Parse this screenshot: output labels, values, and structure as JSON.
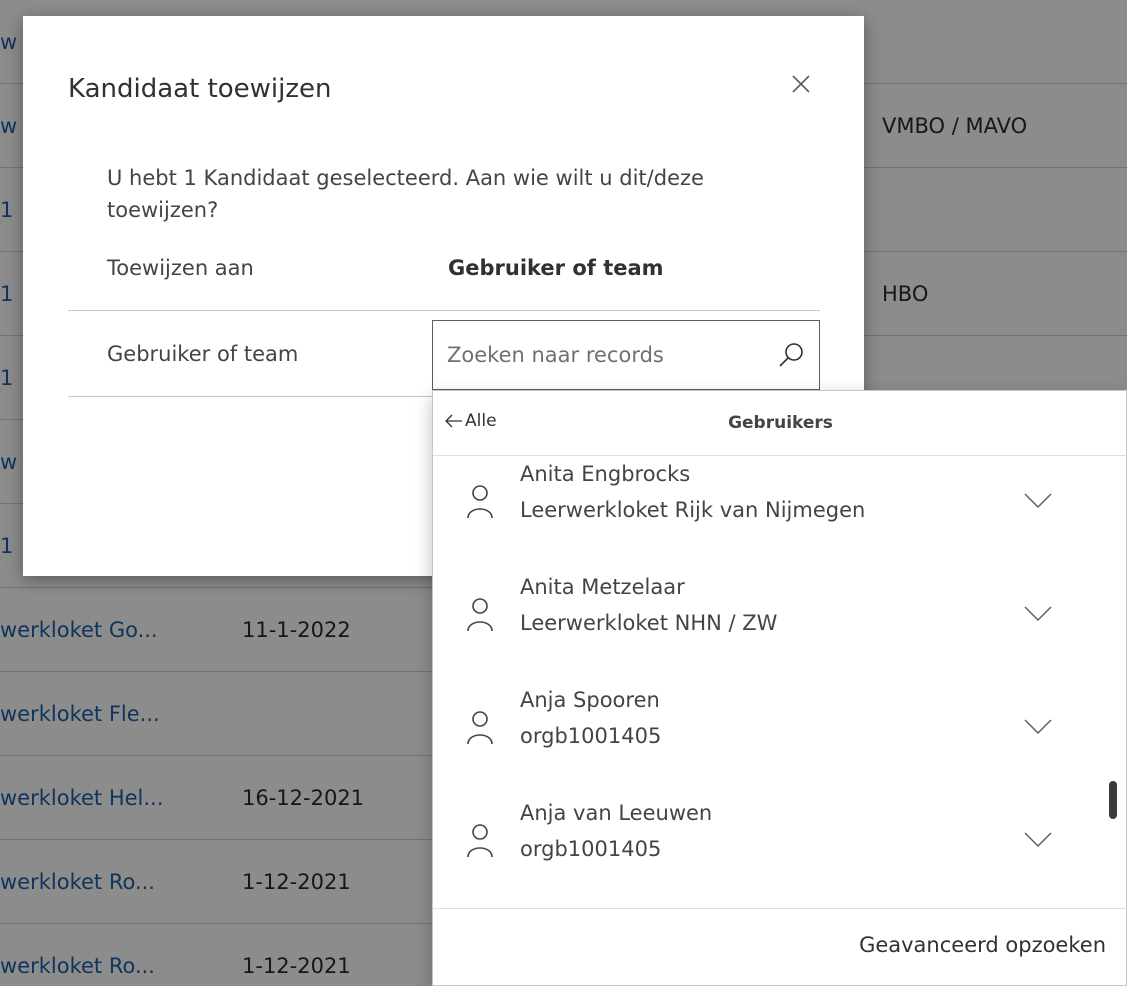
{
  "background_table": {
    "rows": [
      {
        "col1": "w",
        "col2": "",
        "col3": ""
      },
      {
        "col1": "w",
        "col2": "",
        "col3": "VMBO / MAVO"
      },
      {
        "col1": "1",
        "col2": "",
        "col3": ""
      },
      {
        "col1": "1",
        "col2": "",
        "col3": "HBO"
      },
      {
        "col1": "1",
        "col2": "",
        "col3": ""
      },
      {
        "col1": "w",
        "col2": "",
        "col3": ""
      },
      {
        "col1": "1",
        "col2": "",
        "col3": ""
      },
      {
        "col1": "werkloket Go...",
        "col2": "11-1-2022",
        "col3": ""
      },
      {
        "col1": "werkloket Fle...",
        "col2": "",
        "col3": ""
      },
      {
        "col1": "werkloket Hel...",
        "col2": "16-12-2021",
        "col3": ""
      },
      {
        "col1": "werkloket Ro...",
        "col2": "1-12-2021",
        "col3": ""
      },
      {
        "col1": "werkloket Ro...",
        "col2": "1-12-2021",
        "col3": ""
      }
    ]
  },
  "dialog": {
    "title": "Kandidaat toewijzen",
    "description": "U hebt 1 Kandidaat geselecteerd. Aan wie wilt u dit/deze toewijzen?",
    "assign_to_label": "Toewijzen aan",
    "assign_to_value": "Gebruiker of team",
    "field_label": "Gebruiker of team",
    "search_placeholder": "Zoeken naar records"
  },
  "flyout": {
    "back_label": "Alle",
    "title": "Gebruikers",
    "items": [
      {
        "name": "Anita Engbrocks",
        "sub": "Leerwerkloket Rijk van Nijmegen"
      },
      {
        "name": "Anita Metzelaar",
        "sub": "Leerwerkloket NHN / ZW"
      },
      {
        "name": "Anja Spooren",
        "sub": "orgb1001405"
      },
      {
        "name": "Anja van Leeuwen",
        "sub": "orgb1001405"
      }
    ],
    "footer_link": "Geavanceerd opzoeken"
  },
  "icons": {
    "close": "close-icon",
    "search": "search-icon",
    "back": "arrow-left-icon",
    "person": "person-icon",
    "chevron": "chevron-down-icon"
  }
}
